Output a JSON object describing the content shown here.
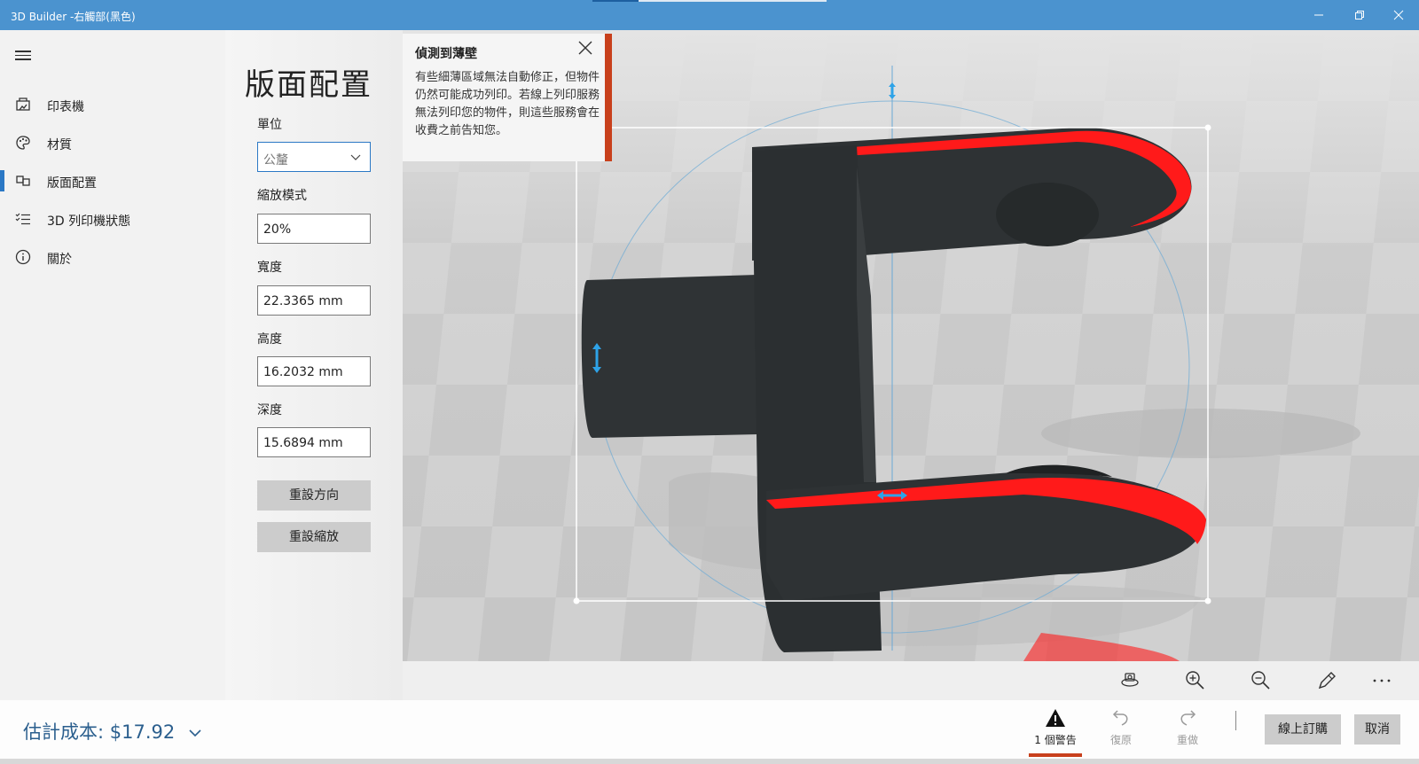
{
  "window": {
    "title": "3D Builder -右觸部(黑色)"
  },
  "nav": {
    "items": [
      {
        "label": "印表機",
        "icon": "printer-icon"
      },
      {
        "label": "材質",
        "icon": "palette-icon"
      },
      {
        "label": "版面配置",
        "icon": "layout-icon",
        "active": true
      },
      {
        "label": "3D 列印機狀態",
        "icon": "status-list-icon"
      },
      {
        "label": "關於",
        "icon": "info-icon"
      }
    ]
  },
  "panel": {
    "title": "版面配置",
    "unit_label": "單位",
    "unit_value": "公釐",
    "scale_mode_label": "縮放模式",
    "scale_mode_value": "20%",
    "width_label": "寬度",
    "width_value": "22.3365 mm",
    "height_label": "高度",
    "height_value": "16.2032 mm",
    "depth_label": "深度",
    "depth_value": "15.6894 mm",
    "reset_orientation": "重設方向",
    "reset_scale": "重設縮放"
  },
  "warning_popup": {
    "title": "偵測到薄壁",
    "body": "有些細薄區域無法自動修正，但物件仍然可能成功列印。若線上列印服務無法列印您的物件，則這些服務會在收費之前告知您。"
  },
  "toolbar": {
    "icons": [
      "camera-rotate-icon",
      "zoom-in-icon",
      "zoom-out-icon",
      "pen-icon",
      "more-icon"
    ]
  },
  "bottom": {
    "cost_label": "估計成本: $17.92",
    "warnings_label": "1 個警告",
    "undo_label": "復原",
    "redo_label": "重做",
    "order_online": "線上訂購",
    "cancel": "取消"
  },
  "colors": {
    "titlebar": "#4b93cf",
    "accent": "#2b78c5",
    "warning": "#c8401c",
    "thin_wall": "#ff1a1a",
    "model": "#2f3335"
  }
}
